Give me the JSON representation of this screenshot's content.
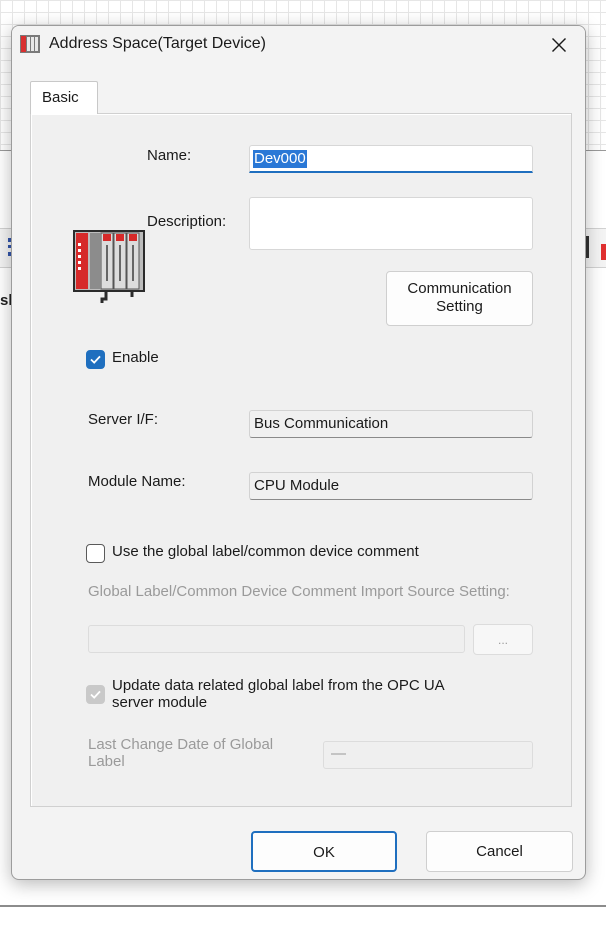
{
  "dialog": {
    "title": "Address Space(Target Device)",
    "close_icon": "close-icon",
    "app_icon": "device-app-icon"
  },
  "tabs": [
    {
      "label": "Basic",
      "active": true
    }
  ],
  "form": {
    "name_label": "Name:",
    "name_value": "Dev000",
    "description_label": "Description:",
    "description_value": "",
    "communication_setting_line1": "Communication",
    "communication_setting_line2": "Setting",
    "enable_label": "Enable",
    "enable_checked": true,
    "server_if_label": "Server I/F:",
    "server_if_value": "Bus Communication",
    "module_name_label": "Module Name:",
    "module_name_value": "CPU Module",
    "global_label_checkbox": "Use the global label/common device comment",
    "global_label_checked": false,
    "import_source_label": "Global Label/Common Device Comment Import Source Setting:",
    "import_source_value": "",
    "browse_label": "...",
    "update_label_line1": "Update data related global label from the OPC UA",
    "update_label_line2": "server module",
    "update_checked": true,
    "last_change_label_line1": "Last Change Date of Global",
    "last_change_label_line2": "Label",
    "last_change_value": "—"
  },
  "footer": {
    "ok_label": "OK",
    "cancel_label": "Cancel"
  },
  "background": {
    "fragment_text": "sh"
  },
  "colors": {
    "accent": "#1f6fbf",
    "selection": "#2a78d6",
    "disabled_text": "#9a9a9a"
  }
}
